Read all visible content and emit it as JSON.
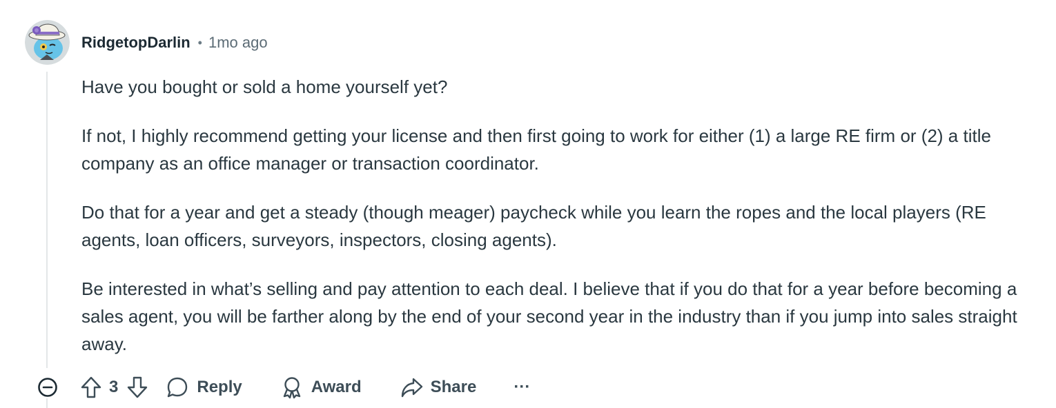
{
  "comment": {
    "author": "RidgetopDarlin",
    "separator": "•",
    "timestamp": "1mo ago",
    "paragraphs": [
      "Have you bought or sold a home yourself yet?",
      "If not, I highly recommend getting your license and then first going to work for either (1) a large RE firm or (2) a title company as an office manager or transaction coordinator.",
      "Do that for a year and get a steady (though meager) paycheck while you learn the ropes and the local players (RE agents, loan officers, surveyors, inspectors, closing agents).",
      "Be interested in what’s selling and pay attention to each deal. I believe that if you do that for a year before becoming a sales agent, you will be farther along by the end of your second year in the industry than if you jump into sales straight away."
    ]
  },
  "actions": {
    "vote_count": "3",
    "reply_label": "Reply",
    "award_label": "Award",
    "share_label": "Share",
    "more_label": "···"
  },
  "icons": {
    "collapse": "minus-circle-icon",
    "upvote": "arrow-up-icon",
    "downvote": "arrow-down-icon",
    "reply": "speech-bubble-icon",
    "award": "award-ribbon-icon",
    "share": "share-arrow-icon",
    "more": "ellipsis-icon"
  },
  "colors": {
    "text": "#2a3840",
    "muted": "#5b6b75",
    "thread_line": "#e3e6e8",
    "action": "#3d4d57"
  }
}
